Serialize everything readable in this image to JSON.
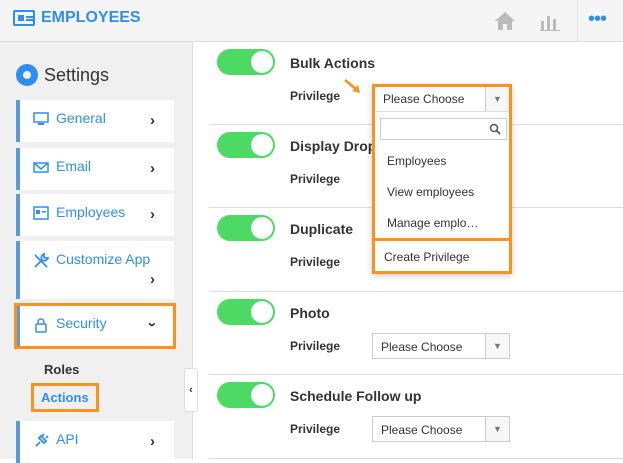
{
  "header": {
    "title": "EMPLOYEES",
    "icons": [
      "home-icon",
      "bar-chart-icon",
      "more-dots-icon"
    ]
  },
  "sidebar": {
    "title": "Settings",
    "items": [
      {
        "label": "General",
        "icon": "monitor-icon"
      },
      {
        "label": "Email",
        "icon": "envelope-icon"
      },
      {
        "label": "Employees",
        "icon": "id-card-icon"
      },
      {
        "label": "Customize App",
        "icon": "wrench-icon"
      },
      {
        "label": "Security",
        "icon": "lock-icon",
        "expanded": true,
        "highlighted": true
      },
      {
        "label": "API",
        "icon": "plug-icon"
      }
    ],
    "security_sub": [
      {
        "label": "Roles"
      },
      {
        "label": "Actions",
        "active": true,
        "highlighted": true
      }
    ]
  },
  "main": {
    "rows": [
      {
        "title": "Bulk Actions",
        "privilege_label": "Privilege",
        "select_value": "Please Choose",
        "enabled": true
      },
      {
        "title": "Display Drop",
        "privilege_label": "Privilege",
        "select_value": "",
        "enabled": true
      },
      {
        "title": "Duplicate",
        "privilege_label": "Privilege",
        "select_value": "",
        "enabled": true
      },
      {
        "title": "Photo",
        "privilege_label": "Privilege",
        "select_value": "Please Choose",
        "enabled": true
      },
      {
        "title": "Schedule Follow up",
        "privilege_label": "Privilege",
        "select_value": "Please Choose",
        "enabled": true
      }
    ],
    "dropdown": {
      "selected": "Please Choose",
      "search_placeholder": "",
      "options": [
        "Employees",
        "View employees",
        "Manage emplo…"
      ],
      "create_label": "Create Privilege"
    }
  },
  "colors": {
    "accent": "#2f8ff0",
    "highlight": "#f7931e",
    "toggle_on": "#4cd964"
  }
}
